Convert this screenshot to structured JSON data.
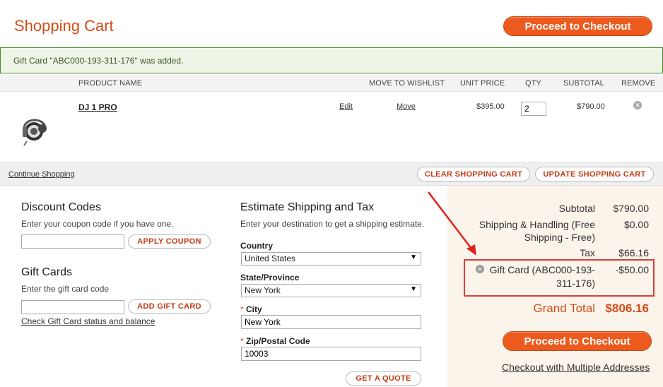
{
  "header": {
    "title": "Shopping Cart",
    "checkout_label": "Proceed to Checkout"
  },
  "message": {
    "text": "Gift Card \"ABC000-193-311-176\" was added."
  },
  "table": {
    "columns": {
      "product_name": "PRODUCT NAME",
      "move_to_wishlist": "MOVE TO WISHLIST",
      "unit_price": "UNIT PRICE",
      "qty": "QTY",
      "subtotal": "SUBTOTAL",
      "remove": "REMOVE"
    },
    "items": [
      {
        "name": "DJ 1 PRO",
        "edit_label": "Edit",
        "move_label": "Move",
        "unit_price": "$395.00",
        "qty": "2",
        "subtotal": "$790.00",
        "image_icon": "headphones-icon"
      }
    ]
  },
  "actions": {
    "continue_label": "Continue Shopping",
    "clear_label": "CLEAR SHOPPING CART",
    "update_label": "UPDATE SHOPPING CART"
  },
  "discount": {
    "title": "Discount Codes",
    "desc": "Enter your coupon code if you have one.",
    "input_value": "",
    "button_label": "APPLY COUPON"
  },
  "giftcards": {
    "title": "Gift Cards",
    "desc": "Enter the gift card code",
    "input_value": "",
    "button_label": "ADD GIFT CARD",
    "check_link": "Check Gift Card status and balance"
  },
  "shipping": {
    "title": "Estimate Shipping and Tax",
    "desc": "Enter your destination to get a shipping estimate.",
    "country_label": "Country",
    "country_value": "United States",
    "state_label": "State/Province",
    "state_value": "New York",
    "required_mark": "*",
    "city_label": "City",
    "city_value": "New York",
    "zip_label": "Zip/Postal Code",
    "zip_value": "10003",
    "quote_label": "GET A QUOTE"
  },
  "totals": {
    "subtotal_label": "Subtotal",
    "subtotal_value": "$790.00",
    "shipping_label_1": "Shipping & Handling (Free",
    "shipping_label_2": "Shipping - Free)",
    "shipping_value": "$0.00",
    "tax_label": "Tax",
    "tax_value": "$66.16",
    "giftcard_label_1": "Gift Card (ABC000-193-",
    "giftcard_label_2": "311-176)",
    "giftcard_value": "-$50.00",
    "grand_label": "Grand Total",
    "grand_value": "$806.16",
    "checkout_label": "Proceed to Checkout",
    "multi_label": "Checkout with Multiple Addresses"
  },
  "colors": {
    "accent": "#d44b1a",
    "button": "#ec5a1e",
    "success_border": "#4a8a2a",
    "highlight": "#e03a3a"
  }
}
